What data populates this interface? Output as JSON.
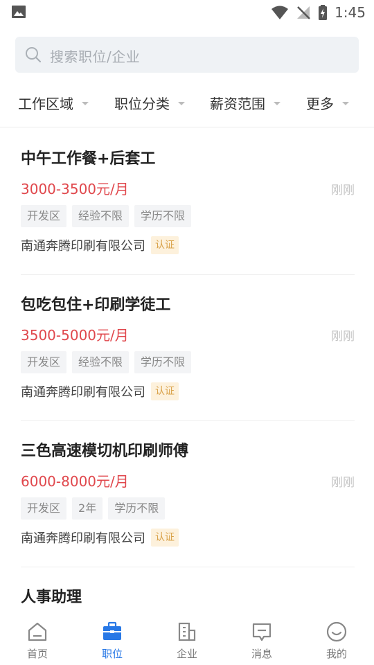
{
  "status_bar": {
    "time": "1:45"
  },
  "search": {
    "placeholder": "搜索职位/企业"
  },
  "filters": [
    {
      "label": "工作区域"
    },
    {
      "label": "职位分类"
    },
    {
      "label": "薪资范围"
    },
    {
      "label": "更多"
    }
  ],
  "jobs": [
    {
      "title": "中午工作餐+后套工",
      "salary": "3000-3500元/月",
      "time": "刚刚",
      "tags": [
        "开发区",
        "经验不限",
        "学历不限"
      ],
      "company": "南通奔腾印刷有限公司",
      "badge": "认证"
    },
    {
      "title": "包吃包住+印刷学徒工",
      "salary": "3500-5000元/月",
      "time": "刚刚",
      "tags": [
        "开发区",
        "经验不限",
        "学历不限"
      ],
      "company": "南通奔腾印刷有限公司",
      "badge": "认证"
    },
    {
      "title": "三色高速模切机印刷师傅",
      "salary": "6000-8000元/月",
      "time": "刚刚",
      "tags": [
        "开发区",
        "2年",
        "学历不限"
      ],
      "company": "南通奔腾印刷有限公司",
      "badge": "认证"
    },
    {
      "title": "人事助理"
    }
  ],
  "bottom_nav": [
    {
      "label": "首页",
      "icon": "home-icon"
    },
    {
      "label": "职位",
      "icon": "briefcase-icon",
      "active": true
    },
    {
      "label": "企业",
      "icon": "building-icon"
    },
    {
      "label": "消息",
      "icon": "message-icon"
    },
    {
      "label": "我的",
      "icon": "profile-icon"
    }
  ],
  "colors": {
    "accent": "#2878e6",
    "salary": "#e0474c",
    "badge_bg": "#fdf1dc",
    "badge_text": "#d9a24a"
  }
}
